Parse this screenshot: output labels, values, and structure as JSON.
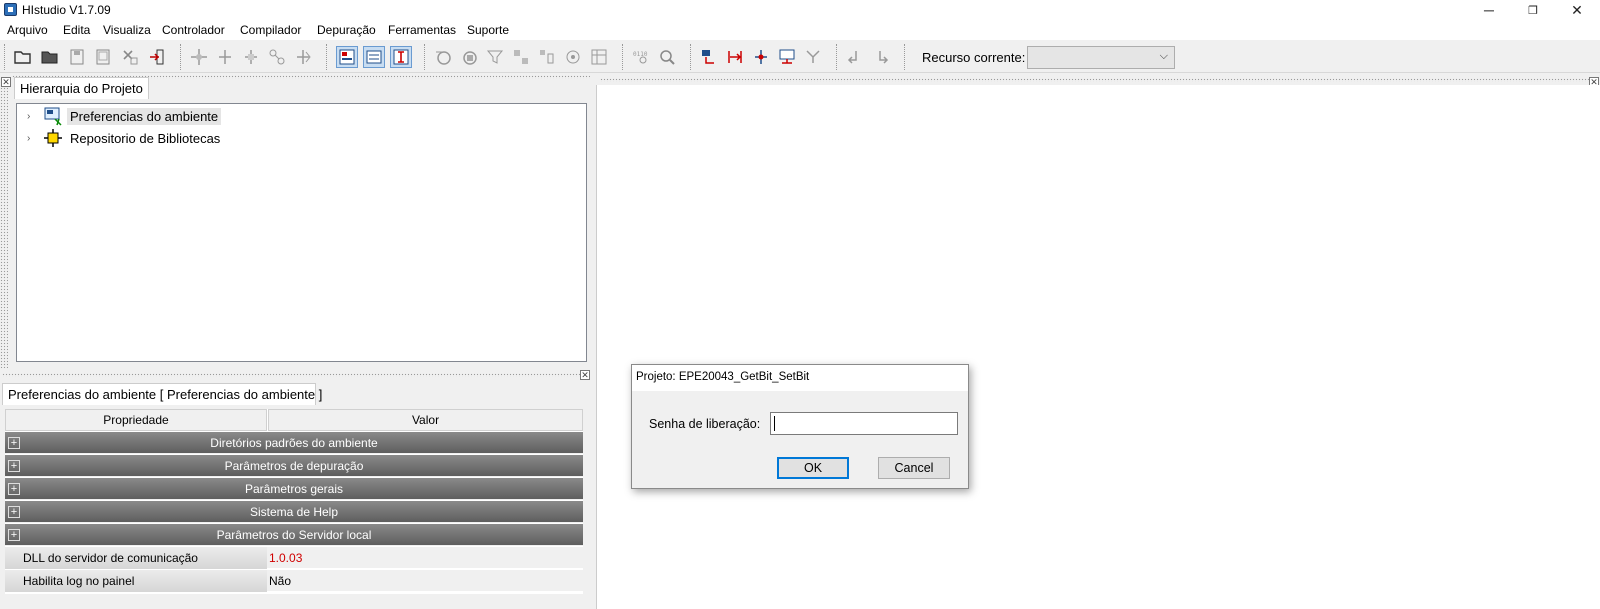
{
  "window": {
    "title": "HIstudio V1.7.09",
    "controls": [
      "minimize-icon",
      "restore-icon",
      "close-icon"
    ]
  },
  "menu": [
    "Arquivo",
    "Edita",
    "Visualiza",
    "Controlador",
    "Compilador",
    "Depuração",
    "Ferramentas",
    "Suporte"
  ],
  "toolbar": {
    "recurso_label": "Recurso corrente:",
    "recurso_value": ""
  },
  "project_panel": {
    "tab": "Hierarquia do Projeto",
    "tree": [
      {
        "label": "Preferencias do ambiente",
        "icon": "preferences-icon",
        "selected": true
      },
      {
        "label": "Repositorio de Bibliotecas",
        "icon": "library-icon",
        "selected": false
      }
    ]
  },
  "properties": {
    "tab": "Preferencias do ambiente [ Preferencias do ambiente ]",
    "col_property": "Propriedade",
    "col_value": "Valor",
    "categories": [
      "Diretórios padrões do ambiente",
      "Parâmetros de depuração",
      "Parâmetros gerais",
      "Sistema de Help",
      "Parâmetros do Servidor local"
    ],
    "rows": [
      {
        "name": "DLL do servidor de comunicação",
        "value": "1.0.03",
        "color": "#d00000"
      },
      {
        "name": "Habilita log no painel",
        "value": "Não",
        "color": "#000000"
      }
    ]
  },
  "dialog": {
    "title": "Projeto: EPE20043_GetBit_SetBit",
    "label": "Senha de liberação:",
    "input_value": "",
    "ok": "OK",
    "cancel": "Cancel"
  }
}
